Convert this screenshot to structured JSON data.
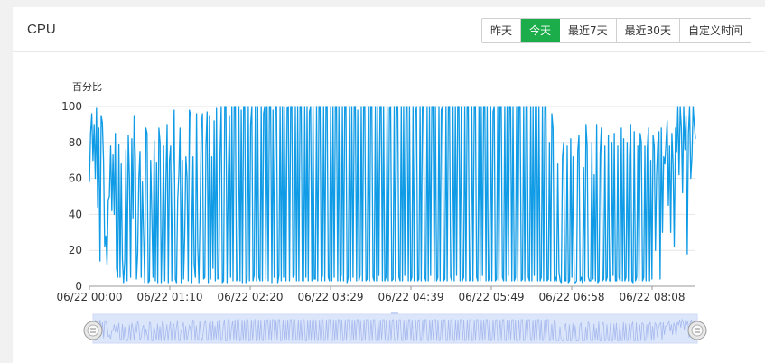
{
  "panel": {
    "title": "CPU"
  },
  "range_buttons": [
    {
      "label": "昨天",
      "active": false
    },
    {
      "label": "今天",
      "active": true
    },
    {
      "label": "最近7天",
      "active": false
    },
    {
      "label": "最近30天",
      "active": false
    },
    {
      "label": "自定义时间",
      "active": false
    }
  ],
  "colors": {
    "series": "#0f9be6",
    "active_button": "#1aad4a",
    "grid": "#e6e6e6",
    "zoom_fill": "#dbe6fb",
    "zoom_line": "#a7b9ee"
  },
  "chart_data": {
    "type": "line",
    "ylabel": "百分比",
    "ylim": [
      0,
      100
    ],
    "y_ticks": [
      "0",
      "20",
      "40",
      "60",
      "80",
      "100"
    ],
    "x_ticks": [
      "06/22 00:00",
      "06/22 01:10",
      "06/22 02:20",
      "06/22 03:29",
      "06/22 04:39",
      "06/22 05:49",
      "06/22 06:58",
      "06/22 08:08"
    ],
    "x_range_minutes": [
      0,
      515
    ],
    "grid": "horizontal",
    "series": [
      {
        "minutes": [
          0,
          1,
          2,
          3,
          4,
          5,
          6,
          7,
          8,
          9,
          10,
          11,
          12,
          13,
          14,
          15,
          16,
          17,
          18,
          19,
          20,
          21,
          22,
          23,
          24,
          25,
          26,
          27,
          28,
          29,
          30,
          31,
          32,
          33,
          34,
          35,
          36,
          37,
          38,
          39,
          40,
          41,
          42,
          43,
          44,
          45,
          46,
          47,
          48,
          49,
          50,
          51,
          52,
          53,
          54,
          55,
          56,
          57,
          58,
          59,
          60,
          61,
          62,
          63,
          64,
          65,
          66,
          67,
          68,
          69,
          70,
          71,
          72,
          73,
          74,
          75,
          76,
          77,
          78,
          79,
          80,
          81,
          82,
          83,
          84,
          85,
          86,
          87,
          88,
          89,
          90,
          91,
          92,
          93,
          94,
          95,
          96,
          97,
          98,
          99,
          100,
          101,
          102,
          103,
          104,
          105,
          106,
          107,
          108,
          109,
          110,
          111,
          112,
          113,
          114,
          115,
          116,
          117,
          118,
          119,
          120,
          121,
          122,
          123,
          124,
          125,
          126,
          127,
          128,
          129,
          130,
          131,
          132,
          133,
          134,
          135,
          136,
          137,
          138,
          139,
          140,
          141,
          142,
          143,
          144,
          145,
          146,
          147,
          148,
          149,
          150,
          151,
          152,
          153,
          154,
          155,
          156,
          157,
          158,
          159,
          160,
          161,
          162,
          163,
          164,
          165,
          166,
          167,
          168,
          169,
          170,
          171,
          172,
          173,
          174,
          175,
          176,
          177,
          178,
          179,
          180,
          181,
          182,
          183,
          184,
          185,
          186,
          187,
          188,
          189,
          190,
          191,
          192,
          193,
          194,
          195,
          196,
          197,
          198,
          199,
          200,
          201,
          202,
          203,
          204,
          205,
          206,
          207,
          208,
          209,
          210,
          211,
          212,
          213,
          214,
          215,
          216,
          217,
          218,
          219,
          220,
          221,
          222,
          223,
          224,
          225,
          226,
          227,
          228,
          229,
          230,
          231,
          232,
          233,
          234,
          235,
          236,
          237,
          238,
          239,
          240,
          241,
          242,
          243,
          244,
          245,
          246,
          247,
          248,
          249,
          250,
          251,
          252,
          253,
          254,
          255,
          256,
          257,
          258,
          259,
          260,
          261,
          262,
          263,
          264,
          265,
          266,
          267,
          268,
          269,
          270,
          271,
          272,
          273,
          274,
          275,
          276,
          277,
          278,
          279,
          280,
          281,
          282,
          283,
          284,
          285,
          286,
          287,
          288,
          289,
          290,
          291,
          292,
          293,
          294,
          295,
          296,
          297,
          298,
          299,
          300,
          301,
          302,
          303,
          304,
          305,
          306,
          307,
          308,
          309,
          310,
          311,
          312,
          313,
          314,
          315,
          316,
          317,
          318,
          319,
          320,
          321,
          322,
          323,
          324,
          325,
          326,
          327,
          328,
          329,
          330,
          331,
          332,
          333,
          334,
          335,
          336,
          337,
          338,
          339,
          340,
          341,
          342,
          343,
          344,
          345,
          346,
          347,
          348,
          349,
          350,
          351,
          352,
          353,
          354,
          355,
          356,
          357,
          358,
          359,
          360,
          361,
          362,
          363,
          364,
          365,
          366,
          367,
          368,
          369,
          370,
          371,
          372,
          373,
          374,
          375,
          376,
          377,
          378,
          379,
          380,
          381,
          382,
          383,
          384,
          385,
          386,
          387,
          388,
          389,
          390,
          391,
          392,
          393,
          394,
          395,
          396,
          397,
          398,
          399,
          400,
          401,
          402,
          403,
          404,
          405,
          406,
          407,
          408,
          409,
          410,
          411,
          412,
          413,
          414,
          415,
          416,
          417,
          418,
          419,
          420,
          421,
          422,
          423,
          424,
          425,
          426,
          427,
          428,
          429,
          430,
          431,
          432,
          433,
          434,
          435,
          436,
          437,
          438,
          439,
          440,
          441,
          442,
          443,
          444,
          445,
          446,
          447,
          448,
          449,
          450,
          451,
          452,
          453,
          454,
          455,
          456,
          457,
          458,
          459,
          460,
          461,
          462,
          463,
          464,
          465,
          466,
          467,
          468,
          469,
          470,
          471,
          472,
          473,
          474,
          475,
          476,
          477,
          478,
          479,
          480,
          481,
          482,
          483,
          484,
          485,
          486,
          487,
          488,
          489,
          490,
          491,
          492,
          493,
          494,
          495,
          496,
          497,
          498,
          499,
          500,
          501,
          502,
          503,
          504,
          505,
          506,
          507,
          508,
          509,
          510,
          511,
          512,
          513,
          514,
          515
        ],
        "values": [
          58,
          85,
          96,
          70,
          90,
          60,
          99,
          44,
          88,
          14,
          95,
          91,
          70,
          22,
          28,
          12,
          48,
          50,
          78,
          42,
          73,
          40,
          85,
          10,
          5,
          79,
          5,
          68,
          15,
          2,
          14,
          76,
          3,
          84,
          60,
          5,
          82,
          38,
          95,
          72,
          4,
          18,
          60,
          75,
          5,
          58,
          30,
          2,
          88,
          85,
          2,
          3,
          70,
          40,
          5,
          81,
          3,
          69,
          2,
          88,
          80,
          2,
          32,
          78,
          3,
          59,
          90,
          2,
          70,
          78,
          3,
          62,
          98,
          4,
          2,
          48,
          62,
          88,
          2,
          70,
          4,
          28,
          72,
          60,
          3,
          98,
          95,
          2,
          72,
          12,
          5,
          96,
          22,
          2,
          40,
          88,
          96,
          4,
          5,
          78,
          97,
          2,
          95,
          4,
          72,
          10,
          92,
          3,
          99,
          4,
          5,
          72,
          100,
          2,
          3,
          100,
          100,
          2,
          60,
          95,
          5,
          100,
          3,
          100,
          100,
          3,
          5,
          100,
          3,
          98,
          2,
          100,
          100,
          2,
          4,
          100,
          3,
          90,
          100,
          3,
          6,
          100,
          3,
          100,
          5,
          3,
          100,
          3,
          96,
          100,
          4,
          100,
          3,
          100,
          100,
          2,
          98,
          5,
          100,
          100,
          2,
          6,
          100,
          3,
          100,
          5,
          100,
          3,
          99,
          100,
          3,
          100,
          100,
          5,
          6,
          100,
          3,
          100,
          3,
          100,
          100,
          3,
          3,
          100,
          5,
          100,
          3,
          97,
          100,
          3,
          100,
          4,
          4,
          100,
          3,
          100,
          100,
          3,
          6,
          100,
          3,
          100,
          100,
          5,
          3,
          100,
          3,
          100,
          5,
          100,
          100,
          3,
          100,
          3,
          6,
          100,
          3,
          100,
          100,
          2,
          5,
          100,
          3,
          100,
          5,
          100,
          100,
          3,
          98,
          3,
          6,
          100,
          3,
          100,
          100,
          3,
          4,
          100,
          3,
          100,
          100,
          5,
          3,
          100,
          3,
          100,
          6,
          100,
          100,
          3,
          100,
          3,
          5,
          100,
          3,
          99,
          100,
          3,
          4,
          100,
          3,
          100,
          100,
          5,
          3,
          100,
          3,
          100,
          6,
          100,
          100,
          3,
          100,
          3,
          5,
          100,
          3,
          96,
          100,
          3,
          4,
          100,
          3,
          100,
          100,
          5,
          3,
          100,
          3,
          100,
          6,
          100,
          100,
          3,
          100,
          3,
          5,
          100,
          3,
          98,
          100,
          3,
          4,
          100,
          3,
          100,
          100,
          5,
          3,
          100,
          3,
          100,
          6,
          100,
          100,
          3,
          100,
          3,
          5,
          100,
          3,
          100,
          100,
          3,
          4,
          100,
          3,
          100,
          100,
          5,
          3,
          100,
          3,
          100,
          6,
          100,
          100,
          3,
          100,
          3,
          5,
          100,
          3,
          97,
          100,
          3,
          4,
          100,
          3,
          100,
          100,
          5,
          3,
          100,
          3,
          100,
          6,
          100,
          100,
          3,
          100,
          3,
          5,
          100,
          3,
          100,
          100,
          3,
          4,
          100,
          3,
          100,
          100,
          5,
          3,
          100,
          3,
          100,
          6,
          100,
          100,
          3,
          100,
          3,
          5,
          100,
          3,
          100,
          100,
          3,
          4,
          80,
          3,
          96,
          88,
          3,
          5,
          3,
          68,
          8,
          3,
          2,
          72,
          80,
          3,
          3,
          78,
          2,
          3,
          82,
          5,
          72,
          2,
          2,
          3,
          75,
          84,
          3,
          5,
          2,
          66,
          3,
          90,
          78,
          5,
          3,
          3,
          80,
          4,
          62,
          3,
          90,
          2,
          3,
          74,
          88,
          3,
          4,
          78,
          3,
          5,
          84,
          3,
          3,
          80,
          6,
          85,
          3,
          3,
          78,
          5,
          3,
          88,
          3,
          82,
          3,
          5,
          80,
          3,
          72,
          90,
          3,
          2,
          86,
          3,
          5,
          78,
          3,
          85,
          80,
          3,
          5,
          78,
          3,
          76,
          88,
          3,
          70,
          4,
          84,
          78,
          20,
          62,
          80,
          86,
          4,
          88,
          30,
          72,
          68,
          80,
          92,
          45,
          78,
          30,
          85,
          68,
          22,
          88,
          75,
          100,
          62,
          100,
          88,
          52,
          100,
          76,
          95,
          18,
          85,
          100,
          60,
          72,
          100,
          90,
          82,
          96,
          30,
          100,
          90,
          100,
          70,
          85,
          96,
          100,
          58,
          92,
          18,
          95,
          100,
          70,
          96,
          30,
          88,
          100,
          72,
          92,
          62,
          95,
          100,
          80,
          100,
          70,
          90,
          100,
          60,
          96,
          28,
          100,
          88,
          98,
          92,
          68,
          100,
          93,
          68
        ]
      }
    ]
  }
}
